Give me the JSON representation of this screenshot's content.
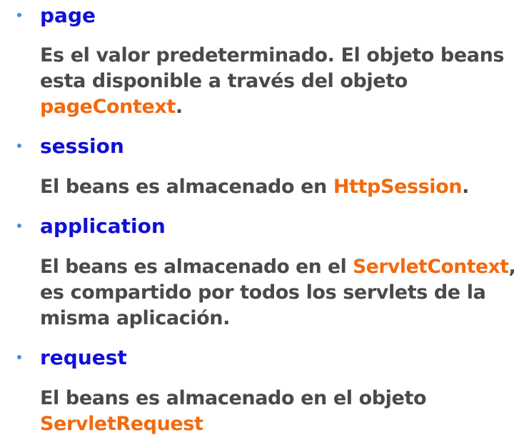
{
  "items": [
    {
      "term": "page",
      "lines": [
        {
          "pre": "Es el valor predeterminado. El objeto beans",
          "hl": "",
          "post": ""
        },
        {
          "pre": "esta disponible a través del objeto",
          "hl": "",
          "post": ""
        },
        {
          "pre": "",
          "hl": "pageContext",
          "post": "."
        }
      ]
    },
    {
      "term": "session",
      "lines": [
        {
          "pre": "El beans es almacenado en ",
          "hl": "HttpSession",
          "post": "."
        }
      ]
    },
    {
      "term": "application",
      "lines": [
        {
          "pre": "El beans es almacenado en el ",
          "hl": "ServletContext",
          "post": ","
        },
        {
          "pre": "es compartido por todos los servlets de  la",
          "hl": "",
          "post": ""
        },
        {
          "pre": "misma aplicación.",
          "hl": "",
          "post": ""
        }
      ]
    },
    {
      "term": "request",
      "lines": [
        {
          "pre": "El beans es almacenado en el  objeto",
          "hl": "",
          "post": ""
        },
        {
          "pre": "",
          "hl": "ServletRequest",
          "post": ""
        }
      ]
    }
  ],
  "colors": {
    "term": "#1010d8",
    "text": "#4a4a4a",
    "highlight": "#f26a0f",
    "bullet": "#4a8fd8"
  }
}
